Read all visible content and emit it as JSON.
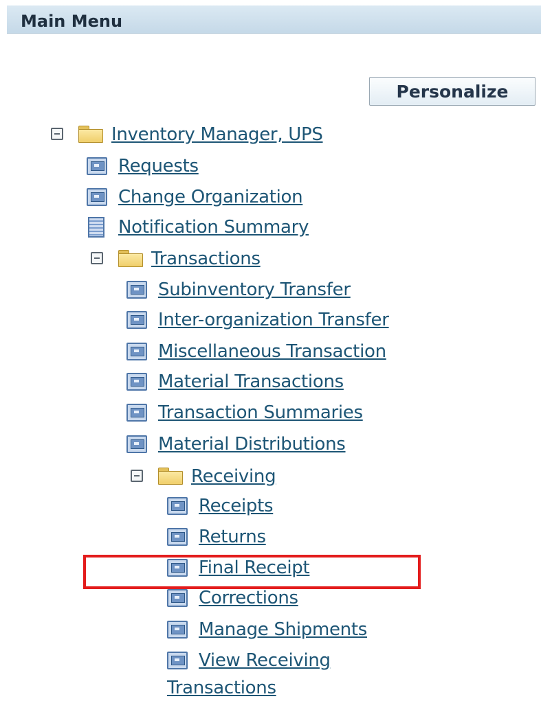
{
  "header": {
    "title": "Main Menu"
  },
  "personalize_label": "Personalize",
  "tree": {
    "root": "Inventory Manager, UPS",
    "requests": "Requests",
    "change_org": "Change Organization",
    "notification_summary": "Notification Summary",
    "transactions": "Transactions",
    "subinventory_transfer": "Subinventory Transfer",
    "inter_org_transfer": "Inter-organization Transfer",
    "misc_transaction": "Miscellaneous Transaction",
    "material_transactions": "Material Transactions",
    "transaction_summaries": "Transaction Summaries",
    "material_distributions": "Material Distributions",
    "receiving": "Receiving",
    "receipts": "Receipts",
    "returns": "Returns",
    "final_receipt": "Final Receipt",
    "corrections": "Corrections",
    "manage_shipments": "Manage Shipments",
    "view_receiving_1": "View Receiving",
    "view_receiving_2": "Transactions"
  },
  "icons": {
    "toggle": "collapse-icon",
    "folder": "folder-icon",
    "function": "function-icon",
    "document": "document-list-icon"
  },
  "highlight_color": "#e31c1c"
}
